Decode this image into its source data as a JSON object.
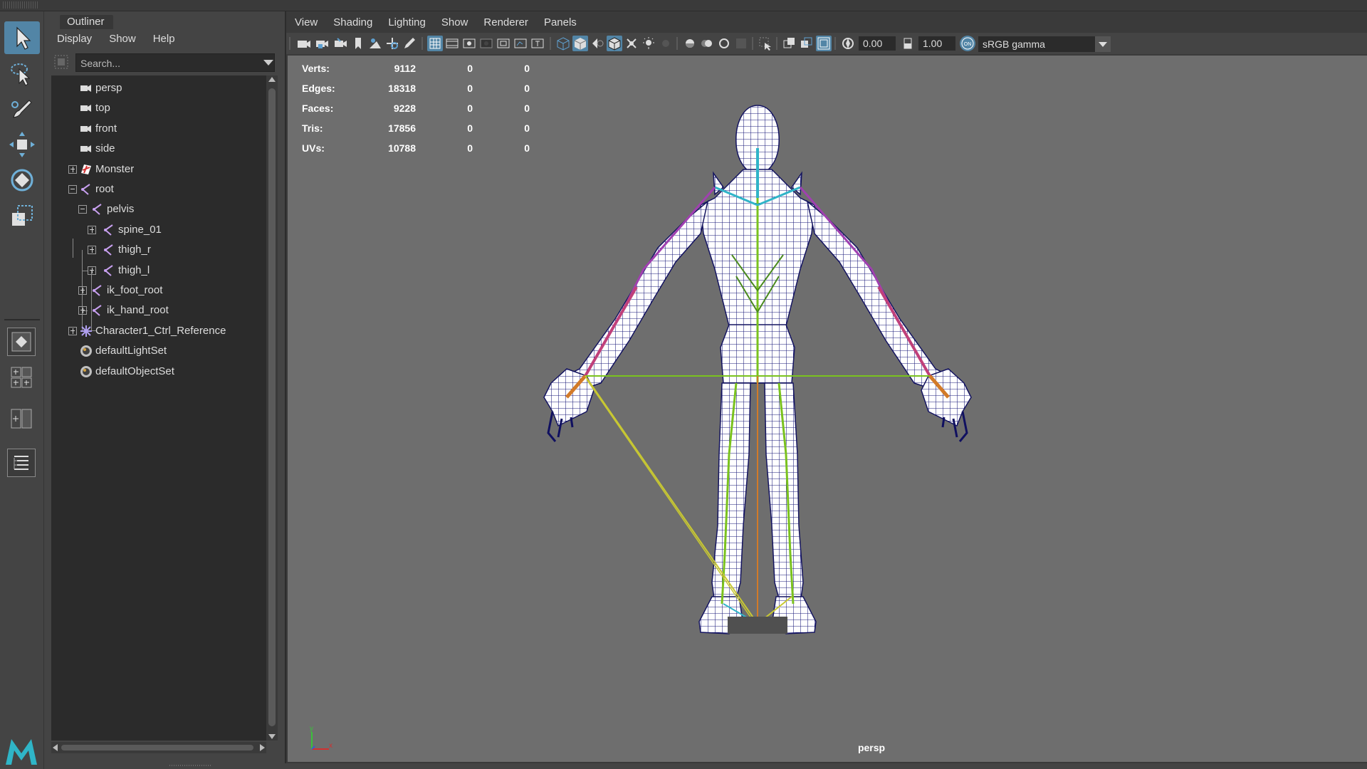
{
  "outliner": {
    "title": "Outliner",
    "menus": [
      "Display",
      "Show",
      "Help"
    ],
    "search_placeholder": "Search...",
    "items": [
      {
        "label": "persp",
        "type": "camera"
      },
      {
        "label": "top",
        "type": "camera"
      },
      {
        "label": "front",
        "type": "camera"
      },
      {
        "label": "side",
        "type": "camera"
      },
      {
        "label": "Monster",
        "type": "mesh"
      },
      {
        "label": "root",
        "type": "joint"
      },
      {
        "label": "pelvis",
        "type": "joint"
      },
      {
        "label": "spine_01",
        "type": "joint"
      },
      {
        "label": "thigh_r",
        "type": "joint"
      },
      {
        "label": "thigh_l",
        "type": "joint"
      },
      {
        "label": "ik_foot_root",
        "type": "joint"
      },
      {
        "label": "ik_hand_root",
        "type": "joint"
      },
      {
        "label": "Character1_Ctrl_Reference",
        "type": "hik-reference"
      },
      {
        "label": "defaultLightSet",
        "type": "set"
      },
      {
        "label": "defaultObjectSet",
        "type": "set"
      }
    ]
  },
  "panel": {
    "menus": [
      "View",
      "Shading",
      "Lighting",
      "Show",
      "Renderer",
      "Panels"
    ],
    "exposure": "0.00",
    "gamma": "1.00",
    "color_space": "sRGB gamma"
  },
  "hud": {
    "rows": [
      {
        "label": "Verts:",
        "v1": "9112",
        "v2": "0",
        "v3": "0"
      },
      {
        "label": "Edges:",
        "v1": "18318",
        "v2": "0",
        "v3": "0"
      },
      {
        "label": "Faces:",
        "v1": "9228",
        "v2": "0",
        "v3": "0"
      },
      {
        "label": "Tris:",
        "v1": "17856",
        "v2": "0",
        "v3": "0"
      },
      {
        "label": "UVs:",
        "v1": "10788",
        "v2": "0",
        "v3": "0"
      }
    ],
    "camera": "persp"
  },
  "axis": {
    "y": "y",
    "x": "x"
  },
  "colors": {
    "accent": "#5285a6",
    "viewport_bg": "#6e6e6e",
    "wire": "#1a1a7a",
    "joint_green": "#7ac21e",
    "joint_yellow": "#c8c832",
    "joint_orange": "#d27a28",
    "joint_magenta": "#c0407a",
    "joint_cyan": "#30b4c8"
  }
}
